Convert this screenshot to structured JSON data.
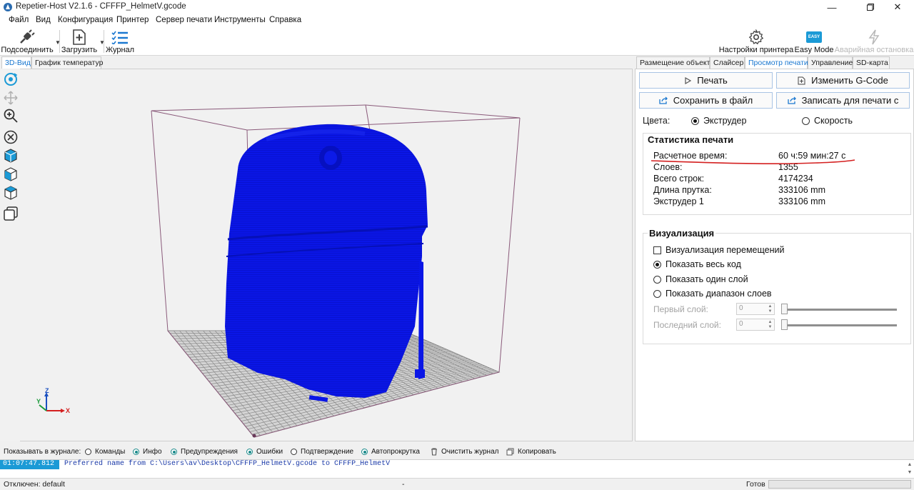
{
  "window": {
    "title": "Repetier-Host V2.1.6 - CFFFP_HelmetV.gcode",
    "controls": [
      "minimize-icon",
      "maximize-icon",
      "close-icon"
    ]
  },
  "menu": [
    "Файл",
    "Вид",
    "Конфигурация",
    "Принтер",
    "Сервер печати",
    "Инструменты",
    "Справка"
  ],
  "toolbar": {
    "connect_label": "Подсоединить",
    "load_label": "Загрузить",
    "log_label": "Журнал",
    "printer_settings_label": "Настройки принтера",
    "easy_mode_label": "Easy Mode",
    "easy_mode_badge": "EASY",
    "emergency_label": "Аварийная остановка"
  },
  "view_tabs": [
    "3D-Вид",
    "График температур"
  ],
  "right_tabs": [
    "Размещение объекта",
    "Слайсер",
    "Просмотр печати",
    "Управление",
    "SD-карта"
  ],
  "preview": {
    "print_button": "Печать",
    "edit_gcode_button": "Изменить G-Code",
    "save_file_button": "Сохранить в файл",
    "write_for_print_button": "Записать для печати с",
    "colors_label": "Цвета:",
    "color_extruder": "Экструдер",
    "color_speed": "Скорость",
    "stats": {
      "title": "Статистика печати",
      "rows": [
        {
          "key": "Расчетное время:",
          "value": "60 ч:59 мин:27 с"
        },
        {
          "key": "Слоев:",
          "value": "1355"
        },
        {
          "key": "Всего строк:",
          "value": "4174234"
        },
        {
          "key": "Длина прутка:",
          "value": "333106 mm"
        },
        {
          "key": "Экструдер 1",
          "value": "333106 mm"
        }
      ]
    },
    "viz": {
      "title": "Визуализация",
      "show_moves": "Визуализация перемещений",
      "show_all": "Показать весь код",
      "show_one_layer": "Показать один слой",
      "show_layer_range": "Показать диапазон слоев",
      "first_layer_label": "Первый слой:",
      "first_layer_value": "0",
      "last_layer_label": "Последний слой:",
      "last_layer_value": "0"
    }
  },
  "axes": {
    "z": "Z",
    "y": "Y",
    "x": "X"
  },
  "log": {
    "show_label": "Показывать в журнале:",
    "filters": [
      {
        "label": "Команды",
        "on": false
      },
      {
        "label": "Инфо",
        "on": true
      },
      {
        "label": "Предупреждения",
        "on": true
      },
      {
        "label": "Ошибки",
        "on": true
      },
      {
        "label": "Подтверждение",
        "on": false
      },
      {
        "label": "Автопрокрутка",
        "on": true
      }
    ],
    "clear_label": "Очистить журнал",
    "copy_label": "Копировать",
    "entry_time": "01:07:47.812",
    "entry_text": "Preferred name from C:\\Users\\av\\Desktop\\CFFFP_HelmetV.gcode to CFFFP_HelmetV"
  },
  "status": {
    "connection": "Отключен: default",
    "middle": "-",
    "ready": "Готов"
  },
  "colors": {
    "accent": "#1b78d0",
    "model_blue": "#0a16e6",
    "bed_grid": "#8a8a8a",
    "bbox_line": "#8a5a7a",
    "annotation_red": "#d42020"
  }
}
